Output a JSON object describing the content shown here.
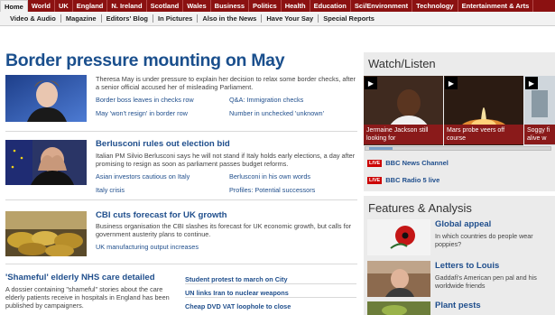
{
  "nav_primary": [
    "Home",
    "World",
    "UK",
    "England",
    "N. Ireland",
    "Scotland",
    "Wales",
    "Business",
    "Politics",
    "Health",
    "Education",
    "Sci/Environment",
    "Technology",
    "Entertainment & Arts"
  ],
  "nav_secondary": [
    "Video & Audio",
    "Magazine",
    "Editors' Blog",
    "In Pictures",
    "Also in the News",
    "Have Your Say",
    "Special Reports"
  ],
  "main_story": {
    "headline": "Border pressure mounting on May",
    "summary": "Theresa May is under pressure to explain her decision to relax some border checks, after a senior official accused her of misleading Parliament.",
    "links": [
      "Border boss leaves in checks row",
      "Q&A: Immigration checks",
      "May 'won't resign' in border row",
      "Number in unchecked 'unknown'"
    ]
  },
  "story2": {
    "title": "Berlusconi rules out election bid",
    "summary": "Italian PM Silvio Berlusconi says he will not stand if Italy holds early elections, a day after promising to resign as soon as parliament passes budget reforms.",
    "links": [
      "Asian investors cautious on Italy",
      "Berlusconi in his own words",
      "Italy crisis",
      "Profiles: Potential successors"
    ]
  },
  "story3": {
    "title": "CBI cuts forecast for UK growth",
    "summary": "Business organisation the CBI slashes its forecast for UK economic growth, but calls for government austerity plans to continue.",
    "links": [
      "UK manufacturing output increases"
    ]
  },
  "story4": {
    "title": "'Shameful' elderly NHS care detailed",
    "summary": "A dossier containing \"shameful\" stories about the care elderly patients receive in hospitals in England has been published by campaigners."
  },
  "headlines_list": [
    "Student protest to march on City",
    "UN links Iran to nuclear weapons",
    "Cheap DVD VAT loophole to close"
  ],
  "watch_listen": {
    "heading": "Watch/Listen",
    "videos": [
      {
        "caption": "Jermaine Jackson still looking for"
      },
      {
        "caption": "Mars probe veers off course"
      },
      {
        "caption": "Soggy fi alive w"
      }
    ],
    "live": [
      {
        "badge": "LIVE",
        "label": "BBC News Channel"
      },
      {
        "badge": "LIVE",
        "label": "BBC Radio 5 live"
      }
    ]
  },
  "features": {
    "heading": "Features & Analysis",
    "items": [
      {
        "title": "Global appeal",
        "text": "In which countries do people wear poppies?"
      },
      {
        "title": "Letters to Louis",
        "text": "Gaddafi's American pen pal and his worldwide friends"
      },
      {
        "title": "Plant pests",
        "text": ""
      }
    ]
  },
  "colors": {
    "nav_red": "#8b1111",
    "link_blue": "#1f4e8c",
    "live_red": "#cc0000"
  }
}
